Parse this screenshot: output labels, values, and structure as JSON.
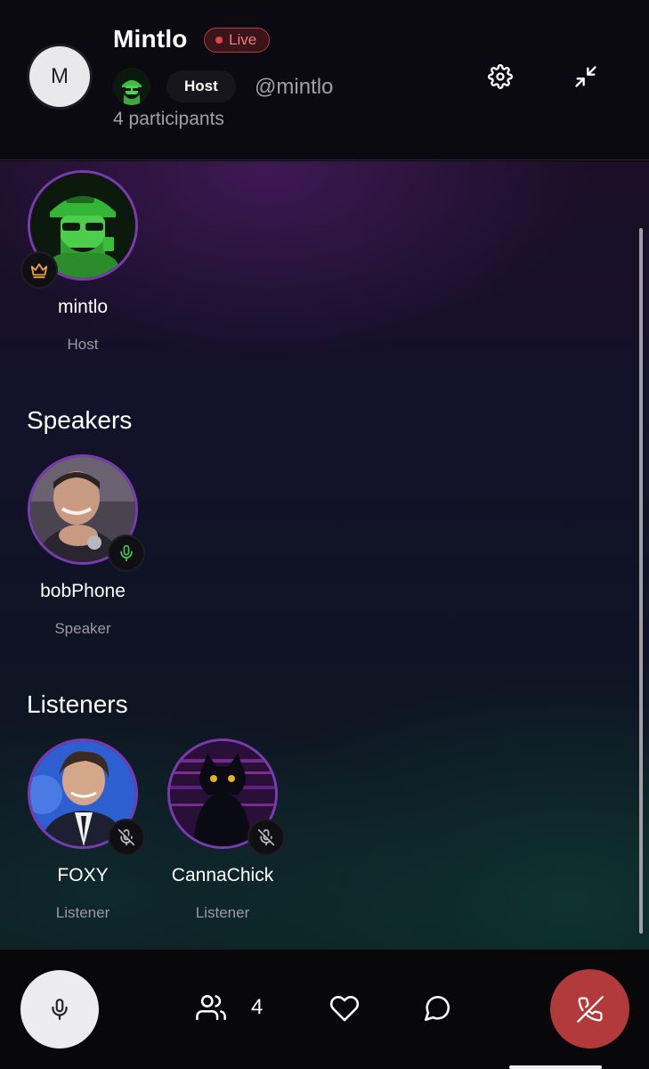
{
  "header": {
    "avatar_initial": "M",
    "title": "Mintlo",
    "live_label": "Live",
    "host_chip": "Host",
    "handle": "@mintlo",
    "participants": "4 participants"
  },
  "sections": {
    "speakers_title": "Speakers",
    "listeners_title": "Listeners"
  },
  "host": {
    "name": "mintlo",
    "role": "Host",
    "badge": "crown-icon"
  },
  "speakers": [
    {
      "name": "bobPhone",
      "role": "Speaker",
      "mic": "mic-on"
    }
  ],
  "listeners": [
    {
      "name": "FOXY",
      "role": "Listener",
      "mic": "mic-off"
    },
    {
      "name": "CannaChick",
      "role": "Listener",
      "mic": "mic-off"
    }
  ],
  "bottom_bar": {
    "people_count": "4"
  },
  "colors": {
    "live_red": "#e0444c",
    "avatar_ring": "#7a3ab0",
    "mic_on_green": "#3ecf5a",
    "end_call_red": "#b23a3a",
    "crown_orange": "#f0a040"
  }
}
